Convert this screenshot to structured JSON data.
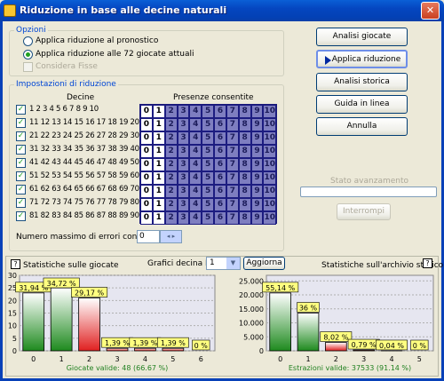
{
  "window": {
    "title": "Riduzione in base alle decine naturali",
    "close": "✕"
  },
  "opzioni": {
    "legend": "Opzioni",
    "radio1": "Applica riduzione al pronostico",
    "radio2": "Applica riduzione alle 72 giocate attuali",
    "check": "Considera Fisse"
  },
  "impostazioni": {
    "legend": "Impostazioni di riduzione",
    "decine_header": "Decine",
    "presenze_header": "Presenze consentite",
    "rows": [
      "1  2  3  4  5  6  7  8  9  10",
      "11 12 13 14 15 16 17 18 19 20",
      "21 22 23 24 25 26 27 28 29 30",
      "31 32 33 34 35 36 37 38 39 40",
      "41 42 43 44 45 46 47 48 49 50",
      "51 52 53 54 55 56 57 58 59 60",
      "61 62 63 64 65 66 67 68 69 70",
      "71 72 73 74 75 76 77 78 79 80",
      "81 82 83 84 85 86 87 88 89 90"
    ],
    "presenze": [
      "0",
      "1",
      "2",
      "3",
      "4",
      "5",
      "6",
      "7",
      "8",
      "9",
      "10"
    ],
    "max_errori_label": "Numero massimo di errori consentiti:",
    "max_errori_value": "0"
  },
  "buttons": {
    "analisi_giocate": "Analisi giocate",
    "applica": "Applica riduzione",
    "analisi_storica": "Analisi storica",
    "guida": "Guida in linea",
    "annulla": "Annulla",
    "interrompi": "Interrompi"
  },
  "stato": {
    "label": "Stato avanzamento"
  },
  "stats": {
    "left_title": "Statistiche sulle giocate",
    "grafici_label": "Grafici decina Nº",
    "decina_value": "1",
    "aggiorna": "Aggiorna",
    "right_title": "Statistiche sull'archivio storico",
    "help": "?",
    "left_footer": "Giocate valide: 48 (66.67 %)",
    "right_footer": "Estrazioni valide: 37533 (91.14 %)"
  },
  "chart_data": [
    {
      "type": "bar",
      "categories": [
        "0",
        "1",
        "2",
        "3",
        "4",
        "5",
        "6"
      ],
      "values": [
        23,
        25,
        21,
        1,
        1,
        1,
        0
      ],
      "labels": [
        "31,94 %",
        "34,72 %",
        "29,17 %",
        "1,39 %",
        "1,39 %",
        "1,39 %",
        "0 %"
      ],
      "ylim": [
        0,
        30
      ],
      "yticks": [
        "0",
        "5",
        "10",
        "15",
        "20",
        "25",
        "30"
      ],
      "colors": [
        "#1e8a1e",
        "#1e8a1e",
        "#e02020",
        "#e02020",
        "#e02020",
        "#e02020",
        "#e02020"
      ]
    },
    {
      "type": "bar",
      "categories": [
        "0",
        "1",
        "2",
        "3",
        "4",
        "5"
      ],
      "values": [
        20690,
        13500,
        3010,
        300,
        15,
        0
      ],
      "labels": [
        "55,14 %",
        "36 %",
        "8,02 %",
        "0,79 %",
        "0,04 %",
        "0 %"
      ],
      "ylim": [
        0,
        27000
      ],
      "yticks": [
        "0",
        "5.000",
        "10.000",
        "15.000",
        "20.000",
        "25.000"
      ],
      "colors": [
        "#1e8a1e",
        "#1e8a1e",
        "#e02020",
        "#e02020",
        "#e02020",
        "#e02020"
      ]
    }
  ]
}
